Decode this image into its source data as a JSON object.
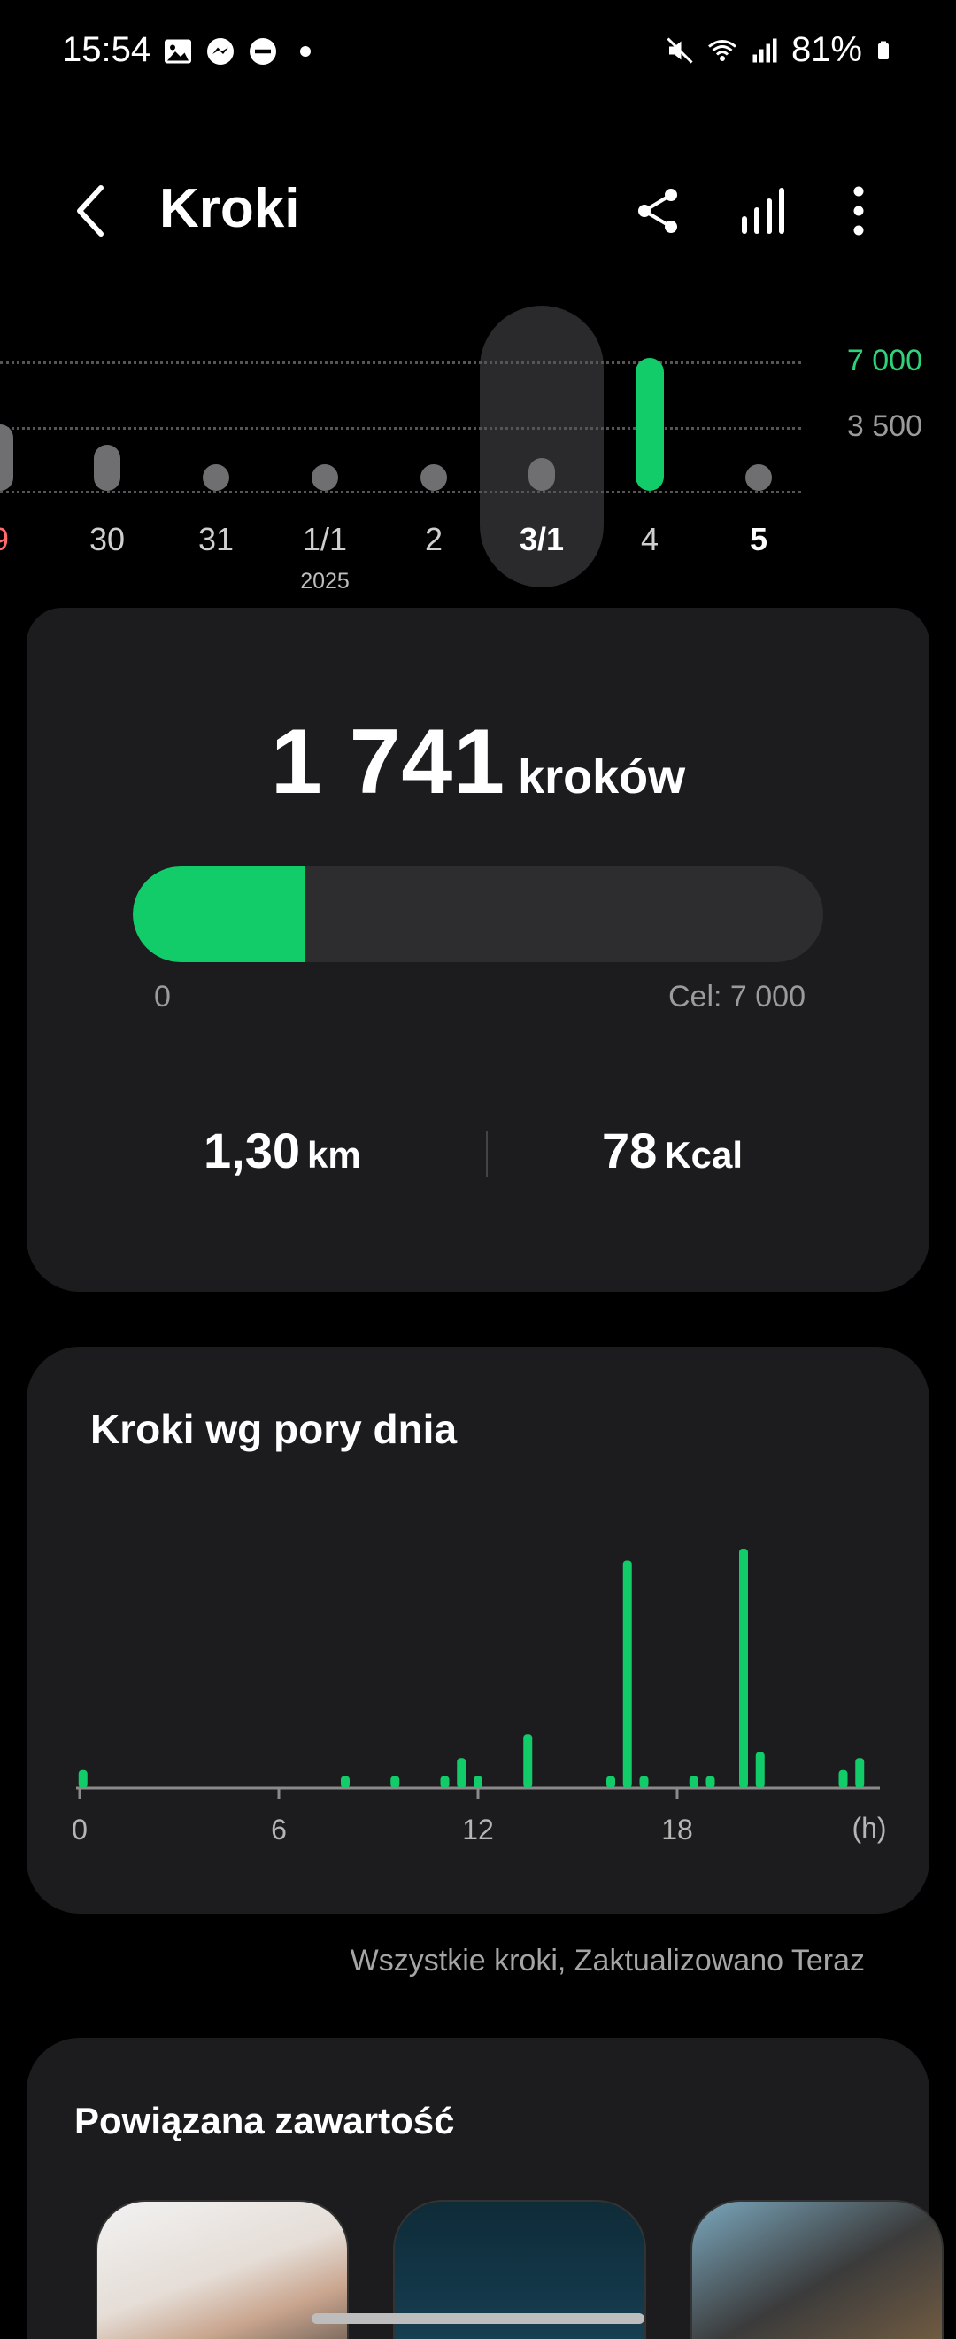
{
  "status_bar": {
    "time": "15:54",
    "battery": "81%"
  },
  "app_bar": {
    "title": "Kroki"
  },
  "week_strip": {
    "goal_label": "7 000",
    "mid_label": "3 500",
    "days": [
      {
        "label": "9",
        "steps_fraction": 0.5,
        "color": "red"
      },
      {
        "label": "30",
        "steps_fraction": 0.35
      },
      {
        "label": "31",
        "steps_fraction": 0.0
      },
      {
        "label": "1/1",
        "sub": "2025",
        "steps_fraction": 0.0
      },
      {
        "label": "2",
        "steps_fraction": 0.0
      },
      {
        "label": "3/1",
        "steps_fraction": 0.25,
        "selected": true
      },
      {
        "label": "4",
        "steps_fraction": 1.0,
        "goal_met": true
      },
      {
        "label": "5",
        "steps_fraction": 0.0,
        "bold": true
      }
    ]
  },
  "summary": {
    "steps": "1 741",
    "steps_unit": "kroków",
    "progress_fraction": 0.249,
    "progress_start": "0",
    "goal_text": "Cel: 7 000",
    "distance_value": "1,30",
    "distance_unit": "km",
    "calories_value": "78",
    "calories_unit": "Kcal"
  },
  "hourly": {
    "title": "Kroki wg pory dnia",
    "x_ticks": [
      "0",
      "6",
      "12",
      "18",
      "(h)"
    ],
    "footnote": "Wszystkie kroki, Zaktualizowano Teraz"
  },
  "chart_data": {
    "type": "bar",
    "title": "Kroki wg pory dnia",
    "xlabel": "(h)",
    "x_ticks": [
      0,
      6,
      12,
      18
    ],
    "xlim": [
      0,
      24
    ],
    "bars": [
      {
        "hour": 0.1,
        "value": 3
      },
      {
        "hour": 8.0,
        "value": 2
      },
      {
        "hour": 9.5,
        "value": 2
      },
      {
        "hour": 11.0,
        "value": 2
      },
      {
        "hour": 11.5,
        "value": 5
      },
      {
        "hour": 12.0,
        "value": 2
      },
      {
        "hour": 13.5,
        "value": 9
      },
      {
        "hour": 16.0,
        "value": 2
      },
      {
        "hour": 16.5,
        "value": 38
      },
      {
        "hour": 17.0,
        "value": 2
      },
      {
        "hour": 18.5,
        "value": 2
      },
      {
        "hour": 19.0,
        "value": 2
      },
      {
        "hour": 20.0,
        "value": 40
      },
      {
        "hour": 20.5,
        "value": 6
      },
      {
        "hour": 23.0,
        "value": 3
      },
      {
        "hour": 23.5,
        "value": 5
      }
    ]
  },
  "related": {
    "title": "Powiązana zawartość"
  },
  "colors": {
    "accent": "#12cc6a",
    "card": "#1c1c1e",
    "background": "#000000"
  }
}
